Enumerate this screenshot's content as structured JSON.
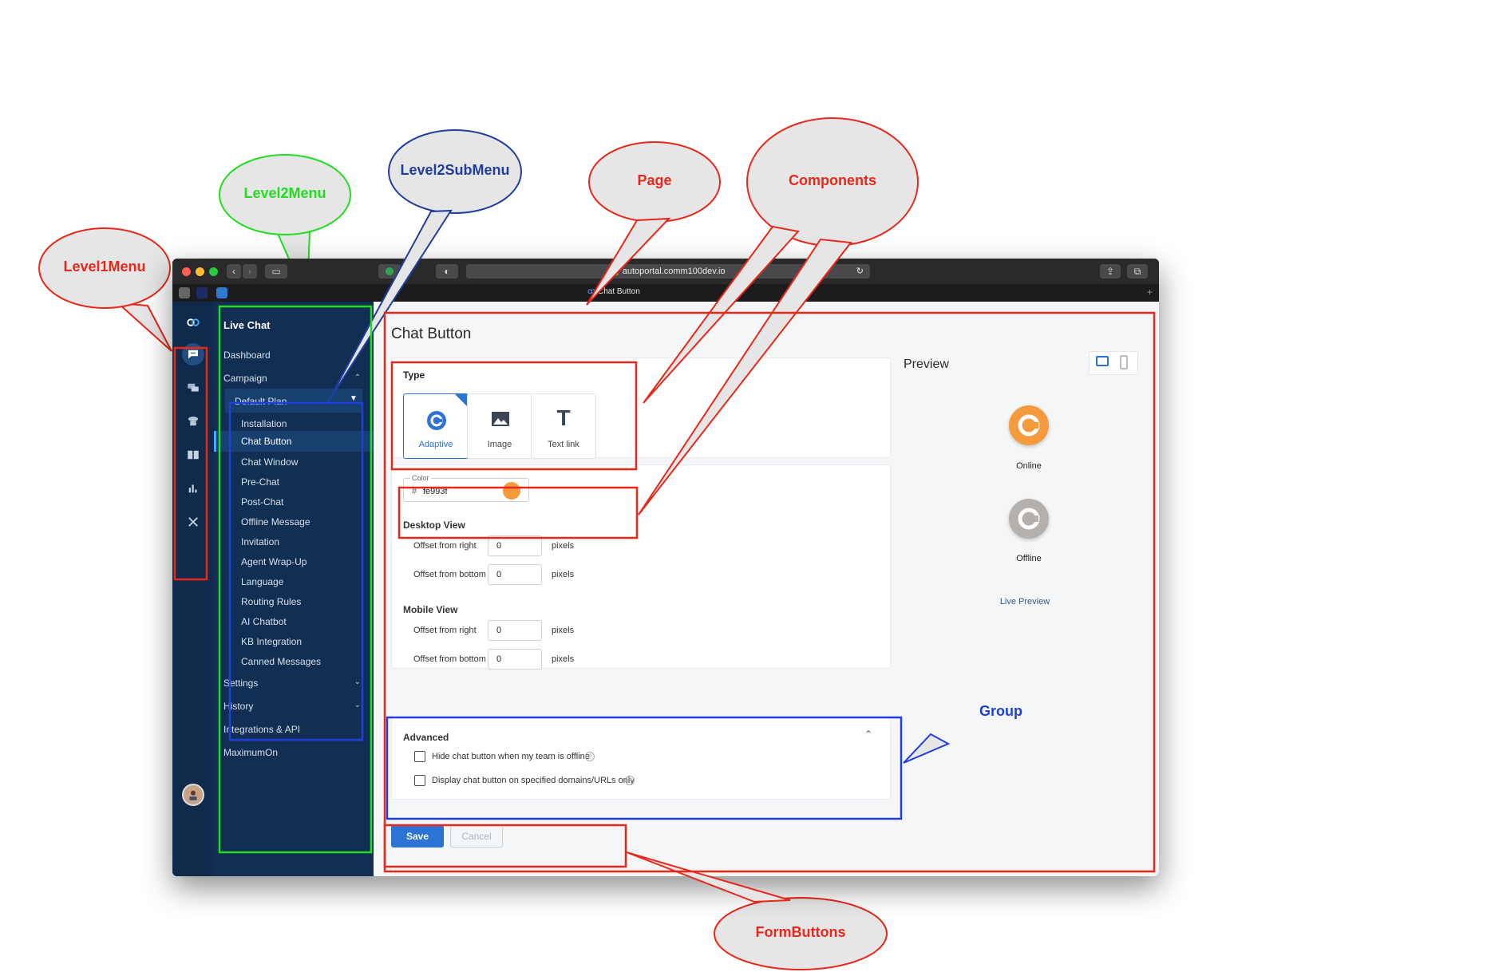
{
  "browser": {
    "url": "autoportal.comm100dev.io",
    "active_tab_title": "Chat Button"
  },
  "level2_menu": {
    "title": "Live Chat",
    "items": {
      "dashboard": "Dashboard",
      "campaign": "Campaign",
      "plan": "Default Plan",
      "settings": "Settings",
      "history": "History",
      "integrations": "Integrations & API",
      "maximumon": "MaximumOn"
    },
    "sub": {
      "installation": "Installation",
      "chat_button": "Chat Button",
      "chat_window": "Chat Window",
      "pre_chat": "Pre-Chat",
      "post_chat": "Post-Chat",
      "offline_message": "Offline Message",
      "invitation": "Invitation",
      "agent_wrap_up": "Agent Wrap-Up",
      "language": "Language",
      "routing_rules": "Routing Rules",
      "ai_chatbot": "AI Chatbot",
      "kb_integration": "KB Integration",
      "canned_messages": "Canned Messages"
    }
  },
  "page": {
    "title": "Chat Button",
    "type": {
      "label": "Type",
      "options": {
        "adaptive": "Adaptive",
        "image": "Image",
        "text_link": "Text link"
      },
      "selected": "Adaptive"
    },
    "color": {
      "label": "Color",
      "hash": "#",
      "value": "fe993f",
      "swatch": "#f59a3d"
    },
    "desktop": {
      "heading": "Desktop View",
      "right_label": "Offset from right",
      "right_value": "0",
      "bottom_label": "Offset from bottom",
      "bottom_value": "0",
      "unit": "pixels"
    },
    "mobile": {
      "heading": "Mobile View",
      "right_label": "Offset from right",
      "right_value": "0",
      "bottom_label": "Offset from bottom",
      "bottom_value": "0",
      "unit": "pixels"
    },
    "advanced": {
      "heading": "Advanced",
      "opt1": "Hide chat button when my team is offline",
      "opt2": "Display chat button on specified domains/URLs only"
    },
    "buttons": {
      "save": "Save",
      "cancel": "Cancel"
    },
    "preview": {
      "title": "Preview",
      "online": "Online",
      "offline": "Offline",
      "live": "Live Preview"
    }
  },
  "annotations": {
    "level1": "Level1Menu",
    "level2": "Level2Menu",
    "level2sub": "Level2SubMenu",
    "page": "Page",
    "components": "Components",
    "group": "Group",
    "formbuttons": "FormButtons"
  },
  "colors": {
    "red": "#e8281a",
    "green": "#22dd22",
    "blue": "#1f3fdd",
    "navy": "#1f3ea0",
    "primary": "#2b74d6",
    "accent_orange": "#f59a3d"
  }
}
